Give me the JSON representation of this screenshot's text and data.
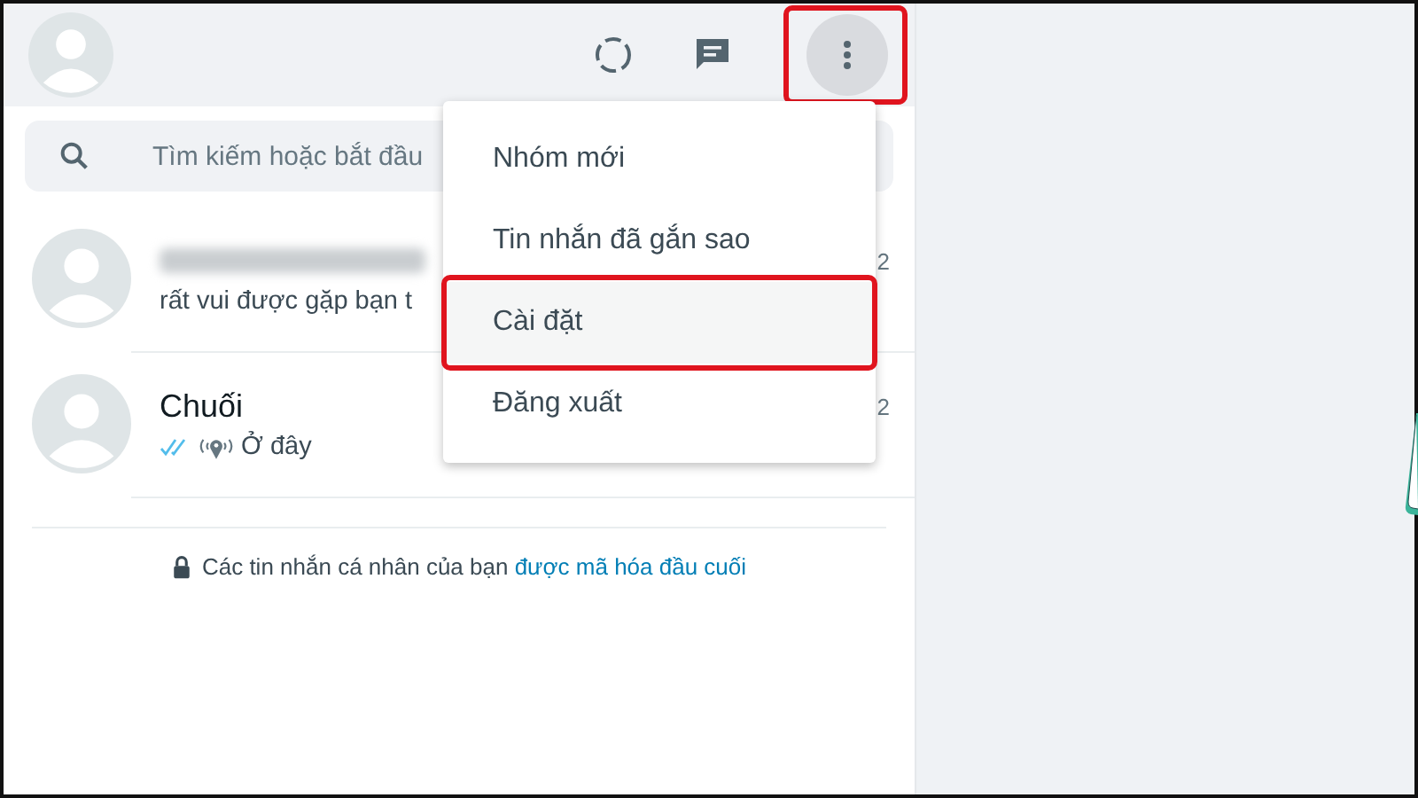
{
  "header": {
    "menu_open": true
  },
  "search": {
    "placeholder": "Tìm kiếm hoặc bắt đầu"
  },
  "chats": [
    {
      "name_redacted": true,
      "preview": "rất vui được gặp bạn t",
      "time": "2",
      "read_ticks": false,
      "location": false
    },
    {
      "name": "Chuối",
      "name_redacted": false,
      "preview": "Ở đây",
      "time": "2",
      "read_ticks": true,
      "location": true
    }
  ],
  "encryption_note": {
    "text": "Các tin nhắn cá nhân của bạn",
    "link": "được mã hóa đầu cuối"
  },
  "menu": [
    {
      "label": "Nhóm mới",
      "selected": false
    },
    {
      "label": "Tin nhắn đã gắn sao",
      "selected": false
    },
    {
      "label": "Cài đặt",
      "selected": true
    },
    {
      "label": "Đăng xuất",
      "selected": false
    }
  ]
}
